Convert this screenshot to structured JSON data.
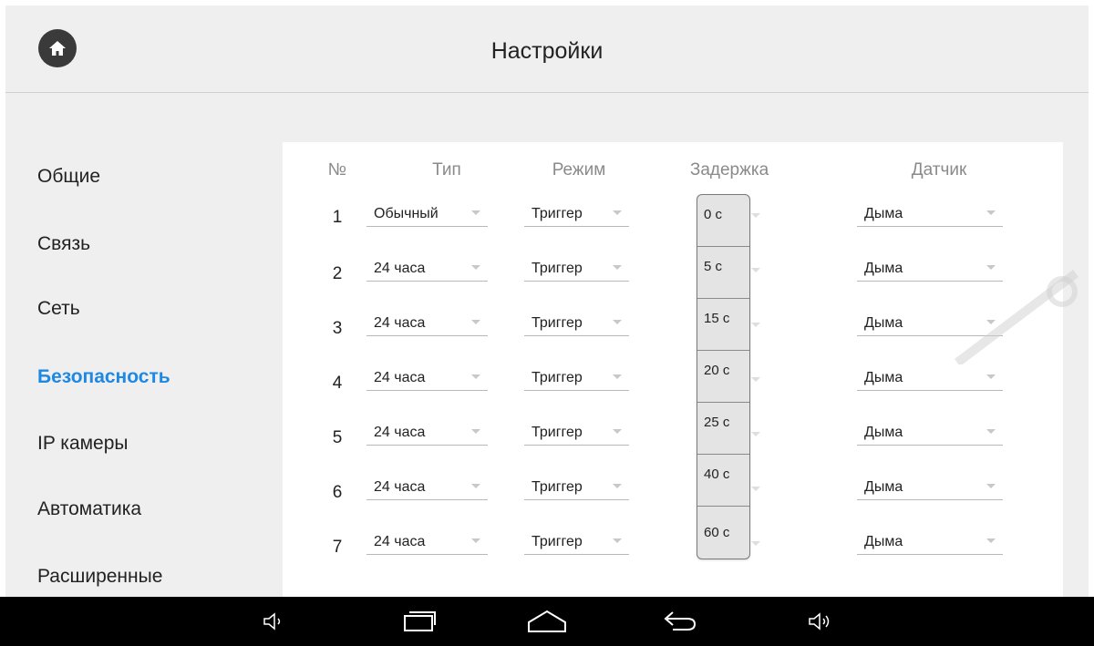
{
  "header": {
    "title": "Настройки",
    "home_icon": "home-icon"
  },
  "sidebar": {
    "items": [
      {
        "label": "Общие",
        "active": false
      },
      {
        "label": "Связь",
        "active": false
      },
      {
        "label": "Сеть",
        "active": false
      },
      {
        "label": "Безопасность",
        "active": true
      },
      {
        "label": "IP камеры",
        "active": false
      },
      {
        "label": "Автоматика",
        "active": false
      },
      {
        "label": "Расширенные",
        "active": false
      }
    ],
    "active_color": "#1e88e5"
  },
  "table": {
    "columns": {
      "num": "№",
      "type": "Тип",
      "mode": "Режим",
      "delay": "Задержка",
      "sensor": "Датчик"
    },
    "rows": [
      {
        "num": "1",
        "type": "Обычный",
        "mode": "Триггер",
        "sensor": "Дыма"
      },
      {
        "num": "2",
        "type": "24 часа",
        "mode": "Триггер",
        "sensor": "Дыма"
      },
      {
        "num": "3",
        "type": "24 часа",
        "mode": "Триггер",
        "sensor": "Дыма"
      },
      {
        "num": "4",
        "type": "24 часа",
        "mode": "Триггер",
        "sensor": "Дыма"
      },
      {
        "num": "5",
        "type": "24 часа",
        "mode": "Триггер",
        "sensor": "Дыма"
      },
      {
        "num": "6",
        "type": "24 часа",
        "mode": "Триггер",
        "sensor": "Дыма"
      },
      {
        "num": "7",
        "type": "24 часа",
        "mode": "Триггер",
        "sensor": "Дыма"
      }
    ]
  },
  "delay_dropdown": {
    "options": [
      "0 с",
      "5 с",
      "15 с",
      "20 с",
      "25 с",
      "40 с",
      "60 с"
    ]
  },
  "navbar": {
    "icons": [
      "volume-down-icon",
      "recent-apps-icon",
      "home-nav-icon",
      "back-icon",
      "volume-up-icon"
    ]
  }
}
